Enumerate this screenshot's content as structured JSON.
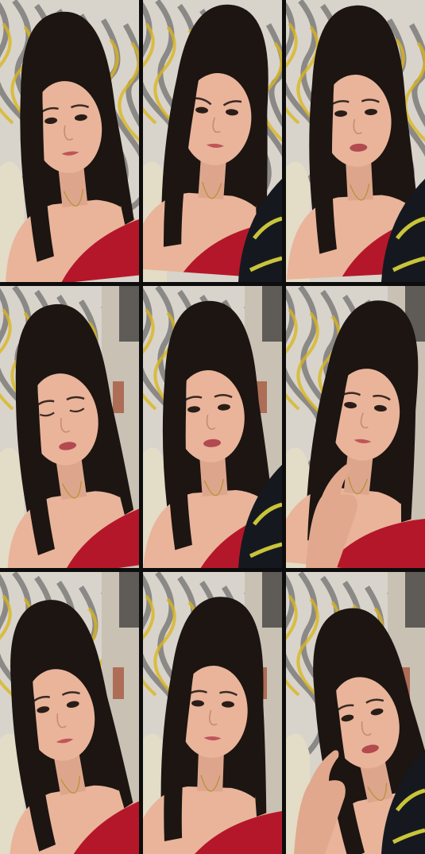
{
  "grid": {
    "rows": 3,
    "columns": 3,
    "tiles": [
      {
        "pose": "head-tilted",
        "top_color": "#b5172a",
        "jacket": false,
        "hand": false,
        "room_wall": false
      },
      {
        "pose": "frown",
        "top_color": "#b5172a",
        "jacket": true,
        "hand": false,
        "room_wall": false
      },
      {
        "pose": "talking",
        "top_color": "#b5172a",
        "jacket": true,
        "hand": false,
        "room_wall": false
      },
      {
        "pose": "eyes-closed",
        "top_color": "#b5172a",
        "jacket": false,
        "hand": false,
        "room_wall": true
      },
      {
        "pose": "talking",
        "top_color": "#b5172a",
        "jacket": true,
        "hand": false,
        "room_wall": true
      },
      {
        "pose": "hand-to-face",
        "top_color": "#b5172a",
        "jacket": false,
        "hand": true,
        "room_wall": true
      },
      {
        "pose": "head-tilted",
        "top_color": "#b5172a",
        "jacket": false,
        "hand": false,
        "room_wall": true
      },
      {
        "pose": "neutral",
        "top_color": "#b5172a",
        "jacket": false,
        "hand": false,
        "room_wall": true
      },
      {
        "pose": "chin-on-hand",
        "top_color": "#b5172a",
        "jacket": true,
        "hand": true,
        "room_wall": true
      }
    ]
  },
  "colors": {
    "background": "#0d0d0d",
    "curtain": "#d8d4cc",
    "curtain_accent": "#d9b51f",
    "curtain_dark": "#4d4a4c",
    "skin": "#e9b49a",
    "hair": "#1c1512",
    "jacket": "#15191f",
    "jacket_pattern": "#c9c43a",
    "wall": "#c9c1b4"
  }
}
